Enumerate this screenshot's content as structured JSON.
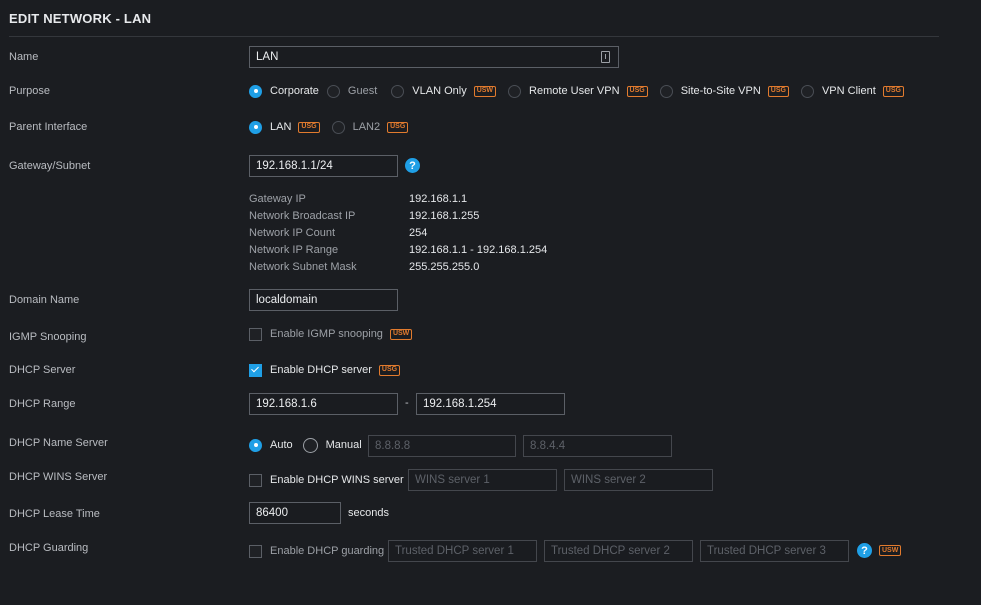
{
  "title": "EDIT NETWORK - LAN",
  "labels": {
    "name": "Name",
    "purpose": "Purpose",
    "parent_interface": "Parent Interface",
    "gateway_subnet": "Gateway/Subnet",
    "domain_name": "Domain Name",
    "igmp_snooping": "IGMP Snooping",
    "dhcp_server": "DHCP Server",
    "dhcp_range": "DHCP Range",
    "dhcp_name_server": "DHCP Name Server",
    "dhcp_wins_server": "DHCP WINS Server",
    "dhcp_lease_time": "DHCP Lease Time",
    "dhcp_guarding": "DHCP Guarding"
  },
  "name": {
    "value": "LAN",
    "icon": "contact-card-icon"
  },
  "purpose": {
    "options": [
      {
        "label": "Corporate",
        "selected": true,
        "badge": ""
      },
      {
        "label": "Guest",
        "selected": false,
        "badge": ""
      },
      {
        "label": "VLAN Only",
        "selected": false,
        "badge": "USW"
      },
      {
        "label": "Remote User VPN",
        "selected": false,
        "badge": "USG"
      },
      {
        "label": "Site-to-Site VPN",
        "selected": false,
        "badge": "USG"
      },
      {
        "label": "VPN Client",
        "selected": false,
        "badge": "USG"
      }
    ]
  },
  "parent_interface": {
    "options": [
      {
        "label": "LAN",
        "selected": true,
        "badge": "USG"
      },
      {
        "label": "LAN2",
        "selected": false,
        "badge": "USG"
      }
    ]
  },
  "gateway_subnet": {
    "value": "192.168.1.1/24",
    "help": "?",
    "info": [
      {
        "key": "Gateway IP",
        "value": "192.168.1.1"
      },
      {
        "key": "Network Broadcast IP",
        "value": "192.168.1.255"
      },
      {
        "key": "Network IP Count",
        "value": "254"
      },
      {
        "key": "Network IP Range",
        "value": "192.168.1.1 - 192.168.1.254"
      },
      {
        "key": "Network Subnet Mask",
        "value": "255.255.255.0"
      }
    ]
  },
  "domain_name": {
    "value": "localdomain"
  },
  "igmp_snooping": {
    "label": "Enable IGMP snooping",
    "checked": false,
    "badge": "USW"
  },
  "dhcp_server": {
    "label": "Enable DHCP server",
    "checked": true,
    "badge": "USG"
  },
  "dhcp_range": {
    "start": "192.168.1.6",
    "separator": "-",
    "end": "192.168.1.254"
  },
  "dhcp_name_server": {
    "auto_label": "Auto",
    "manual_label": "Manual",
    "mode": "auto",
    "server1_placeholder": "8.8.8.8",
    "server2_placeholder": "8.8.4.4"
  },
  "dhcp_wins_server": {
    "label": "Enable DHCP WINS server",
    "checked": false,
    "server1_placeholder": "WINS server 1",
    "server2_placeholder": "WINS server 2"
  },
  "dhcp_lease_time": {
    "value": "86400",
    "unit": "seconds"
  },
  "dhcp_guarding": {
    "label": "Enable DHCP guarding",
    "checked": false,
    "server1_placeholder": "Trusted DHCP server 1",
    "server2_placeholder": "Trusted DHCP server 2",
    "server3_placeholder": "Trusted DHCP server 3",
    "help": "?",
    "badge": "USW"
  },
  "colors": {
    "accent": "#1f9fe6",
    "badge": "#e27b2e",
    "background": "#1b1d21"
  }
}
